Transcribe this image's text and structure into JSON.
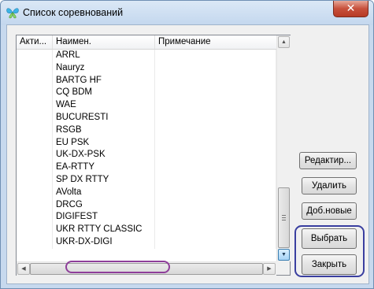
{
  "window": {
    "title": "Список соревнований",
    "close_glyph": "✕"
  },
  "list": {
    "columns": [
      {
        "label": "Акти..."
      },
      {
        "label": "Наимен."
      },
      {
        "label": "Примечание"
      }
    ],
    "rows": [
      {
        "active": "",
        "name": "ARRL",
        "note": ""
      },
      {
        "active": "",
        "name": "Nauryz",
        "note": ""
      },
      {
        "active": "",
        "name": "BARTG HF",
        "note": ""
      },
      {
        "active": "",
        "name": "CQ BDM",
        "note": ""
      },
      {
        "active": "",
        "name": "WAE",
        "note": ""
      },
      {
        "active": "",
        "name": "BUCURESTI",
        "note": ""
      },
      {
        "active": "",
        "name": "RSGB",
        "note": ""
      },
      {
        "active": "",
        "name": "EU PSK",
        "note": ""
      },
      {
        "active": "",
        "name": "UK-DX-PSK",
        "note": ""
      },
      {
        "active": "",
        "name": "EA-RTTY",
        "note": ""
      },
      {
        "active": "",
        "name": "SP DX RTTY",
        "note": ""
      },
      {
        "active": "",
        "name": "AVolta",
        "note": ""
      },
      {
        "active": "",
        "name": "DRCG",
        "note": ""
      },
      {
        "active": "",
        "name": "DIGIFEST",
        "note": ""
      },
      {
        "active": "",
        "name": "UKR RTTY CLASSIC",
        "note": ""
      },
      {
        "active": "",
        "name": "UKR-DX-DIGI",
        "note": ""
      }
    ]
  },
  "buttons": {
    "edit": "Редактир...",
    "delete": "Удалить",
    "add_new": "Доб.новые",
    "select": "Выбрать",
    "close": "Закрыть"
  },
  "colors": {
    "highlight_oval": "#8e3e9a",
    "buttons_oval": "#3a3fa0"
  }
}
